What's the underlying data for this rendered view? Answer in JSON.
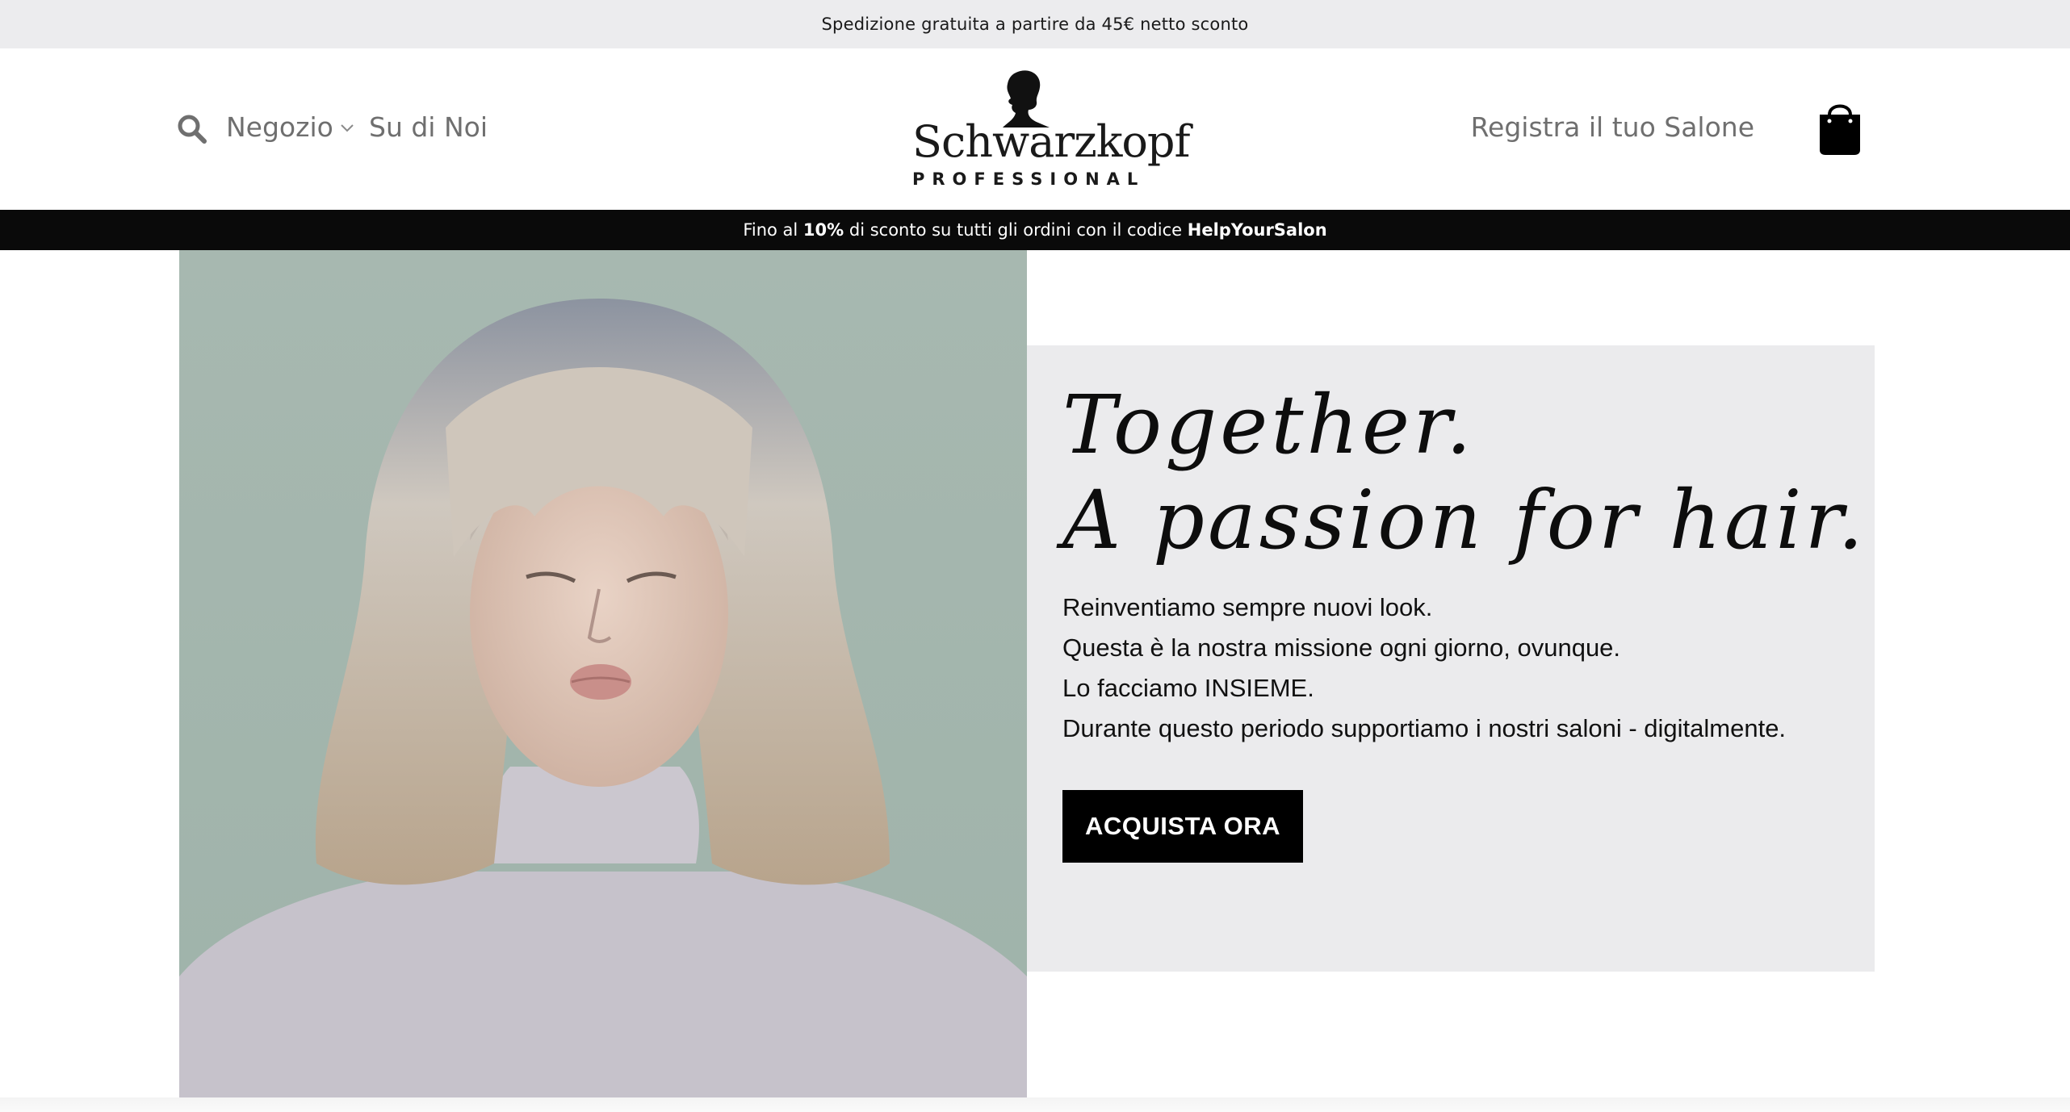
{
  "topbar": {
    "text": "Spedizione gratuita a partire da 45€ netto sconto"
  },
  "header": {
    "nav_shop": "Negozio",
    "nav_about": "Su di Noi",
    "logo_word": "Schwarzkopf",
    "logo_pro": "PROFESSIONAL",
    "register": "Registra il tuo Salone"
  },
  "promo": {
    "part1": "Fino al ",
    "discount": "10%",
    "part2": " di sconto su tutti gli ordini con il codice ",
    "code": "HelpYourSalon"
  },
  "hero": {
    "headline_line1": "Together.",
    "headline_line2": "A passion for hair.",
    "copy_lines": [
      "Reinventiamo sempre nuovi look.",
      "Questa è la nostra missione ogni giorno, ovunque.",
      "Lo facciamo INSIEME.",
      "Durante questo periodo supportiamo i nostri saloni - digitalmente."
    ],
    "cta": "ACQUISTA ORA"
  },
  "colors": {
    "topbar_bg": "#ececee",
    "promo_bg": "#0a0a0a",
    "panel_bg": "#ebebed",
    "image_bg": "#a9b9b2",
    "nav_text": "#6f6f6f"
  },
  "icons": {
    "search": "search-icon",
    "chevron": "chevron-down-icon",
    "bag": "shopping-bag-icon",
    "logo": "silhouette-logo-icon"
  }
}
